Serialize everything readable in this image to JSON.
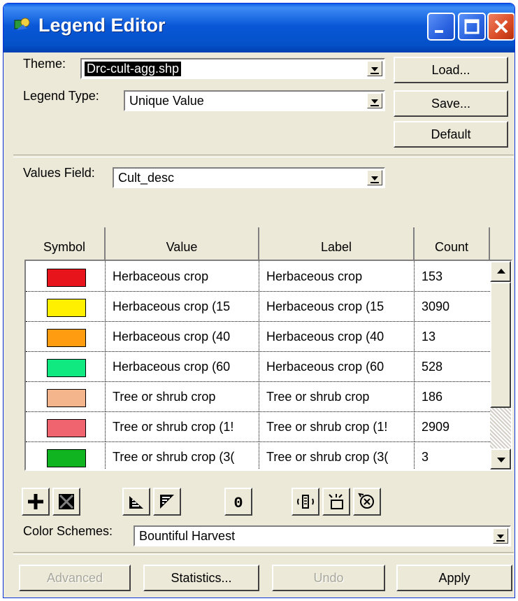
{
  "window": {
    "title": "Legend Editor"
  },
  "theme": {
    "label": "Theme:",
    "value": "Drc-cult-agg.shp"
  },
  "legend_type": {
    "label": "Legend Type:",
    "value": "Unique Value"
  },
  "values_field": {
    "label": "Values Field:",
    "value": "Cult_desc"
  },
  "side_buttons": {
    "load": "Load...",
    "save": "Save...",
    "default": "Default"
  },
  "table": {
    "headers": {
      "symbol": "Symbol",
      "value": "Value",
      "label": "Label",
      "count": "Count"
    },
    "rows": [
      {
        "color": "#e8141c",
        "value": "Herbaceous crop",
        "label": "Herbaceous crop",
        "count": "153"
      },
      {
        "color": "#fff000",
        "value": "Herbaceous crop (15",
        "label": "Herbaceous crop (15",
        "count": "3090"
      },
      {
        "color": "#ff9c10",
        "value": "Herbaceous crop (40",
        "label": "Herbaceous crop (40",
        "count": "13"
      },
      {
        "color": "#10e880",
        "value": "Herbaceous crop (60",
        "label": "Herbaceous crop (60",
        "count": "528"
      },
      {
        "color": "#f4b48c",
        "value": "Tree or shrub crop",
        "label": "Tree or shrub crop",
        "count": "186"
      },
      {
        "color": "#f06470",
        "value": "Tree or shrub crop (1!",
        "label": "Tree or shrub crop (1!",
        "count": "2909"
      },
      {
        "color": "#10b420",
        "value": "Tree or shrub crop (3(",
        "label": "Tree or shrub crop (3(",
        "count": "3"
      }
    ]
  },
  "toolbar": {
    "icons": [
      "add-icon",
      "delete-icon",
      "sort-ascending-icon",
      "sort-descending-icon",
      "null-value-icon",
      "statistics-icon",
      "symbol-icon",
      "reset-icon"
    ],
    "zero_glyph": "0"
  },
  "color_schemes": {
    "label": "Color Schemes:",
    "value": "Bountiful Harvest"
  },
  "bottom_buttons": {
    "advanced": "Advanced",
    "statistics": "Statistics...",
    "undo": "Undo",
    "apply": "Apply"
  }
}
